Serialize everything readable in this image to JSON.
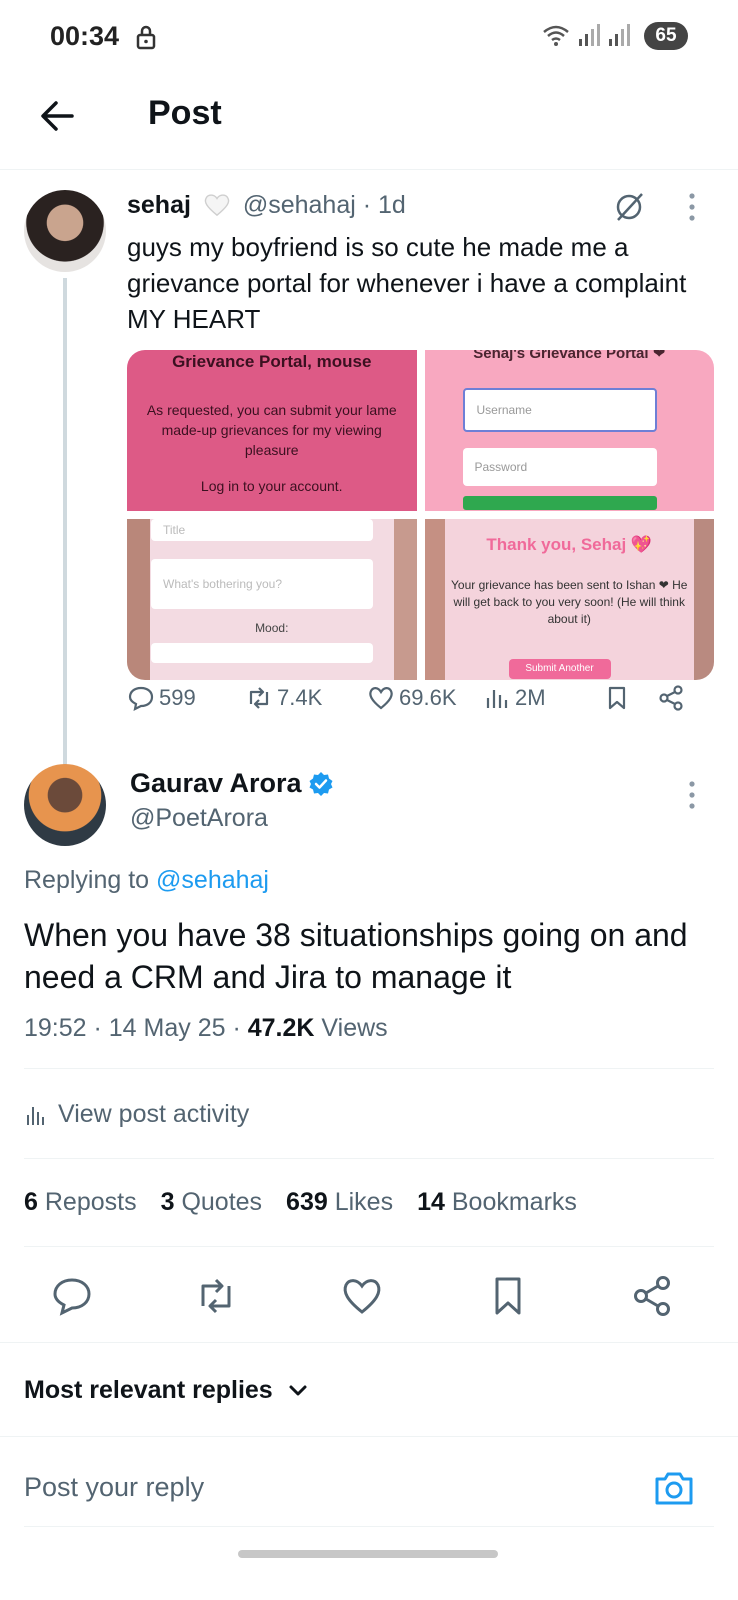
{
  "status_bar": {
    "time": "00:34",
    "battery": "65"
  },
  "header": {
    "title": "Post"
  },
  "original_post": {
    "name": "sehaj",
    "handle": "@sehahaj",
    "age": "· 1d",
    "text": "guys my boyfriend is so cute he made me a grievance portal for whenever i have a complaint MY HEART",
    "media": {
      "img1": {
        "title": "Grievance Portal, mouse",
        "body": "As requested, you can submit your lame made-up grievances for my viewing pleasure",
        "login": "Log in to your account."
      },
      "img2": {
        "title": "Sehaj's Grievance Portal ❤",
        "username_placeholder": "Username",
        "password_placeholder": "Password"
      },
      "img3": {
        "title_placeholder": "Title",
        "what_placeholder": "What's bothering you?",
        "mood_label": "Mood:"
      },
      "img4": {
        "title": "Thank you, Sehaj 💖",
        "body": "Your grievance has been sent to Ishan ❤ He will get back to you very soon! (He will think about it)",
        "button": "Submit Another"
      }
    },
    "stats": {
      "replies": "599",
      "reposts": "7.4K",
      "likes": "69.6K",
      "views": "2M"
    }
  },
  "reply_post": {
    "name": "Gaurav Arora",
    "handle": "@PoetArora",
    "replying_prefix": "Replying to",
    "replying_to": "@sehahaj",
    "text": "When you have 38 situationships going on and need a CRM and Jira to manage it",
    "timestamp": "19:52 · 14 May 25 ·",
    "views_count": "47.2K",
    "views_label": "Views",
    "activity_label": "View post activity",
    "engagement": [
      {
        "count": "6",
        "label": "Reposts"
      },
      {
        "count": "3",
        "label": "Quotes"
      },
      {
        "count": "639",
        "label": "Likes"
      },
      {
        "count": "14",
        "label": "Bookmarks"
      }
    ]
  },
  "replies_sort": {
    "label": "Most relevant replies"
  },
  "reply_box": {
    "placeholder": "Post your reply"
  },
  "colors": {
    "accent": "#1d9bf0",
    "text": "#0f1419",
    "muted": "#536471"
  }
}
